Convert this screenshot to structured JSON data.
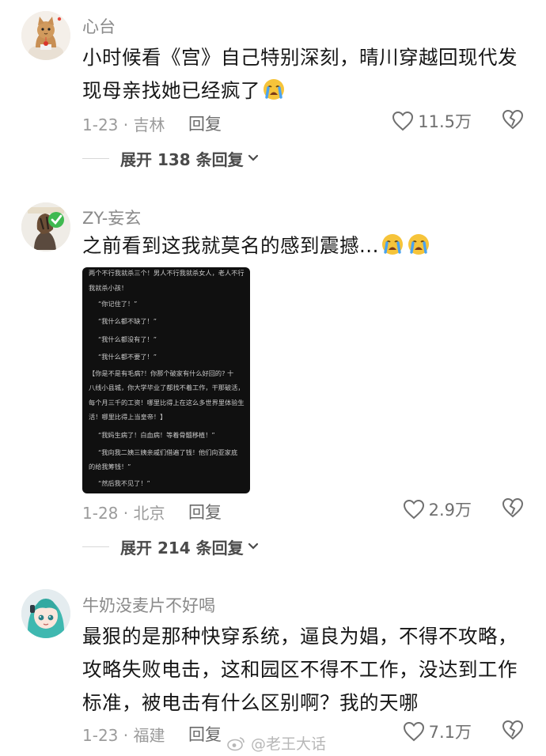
{
  "comments": [
    {
      "username": "心台",
      "content": "小时候看《宫》自己特别深刻，晴川穿越回现代发现母亲找她已经疯了",
      "date": "1-23 · 吉林",
      "reply": "回复",
      "likes": "11.5万",
      "expand": "展开 138 条回复",
      "emoji": [
        "crying-face"
      ]
    },
    {
      "username": "ZY-妄玄",
      "content": "之前看到这我就莫名的感到震撼...",
      "date": "1-28 · 北京",
      "reply": "回复",
      "likes": "2.9万",
      "expand": "展开 214 条回复",
      "emoji": [
        "crying-face",
        "crying-face"
      ],
      "attached_image": {
        "lines": [
          "两个不行我就杀三个！男人不行我就杀女人，老人不行",
          "我就杀小孩！",
          "“你记住了！”",
          "“我什么都不缺了！”",
          "“我什么都没有了！”",
          "“我什么都不要了！”",
          "【你是不是有毛病?！你那个破家有什么好回的? 十",
          "八线小县城，你大学毕业了都找不着工作，干那破活，",
          "每个月三千的工资！哪里比得上在这么多世界里体验生",
          "活！哪里比得上当皇帝！】",
          "“我妈生病了！白血病！等着骨髓移植！”",
          "“我向我二姨三姨亲戚们借遍了钱！他们向亚家底",
          "的给我筹钱！”",
          "“然后我不见了！”"
        ]
      }
    },
    {
      "username": "牛奶没麦片不好喝",
      "content_lines": [
        "最狠的是那种快穿系统，逼良为娼，不得不攻略，",
        "攻略失败电击，这和园区不得不工作，没达到工作",
        "标准，被电击有什么区别啊？我的天哪"
      ],
      "date": "1-23 · 福建",
      "reply": "回复",
      "likes": "7.1万"
    }
  ],
  "watermark": "@老王大话",
  "colors": {
    "text": "#161616",
    "meta": "#9b9b9b",
    "shot_bg": "#101010",
    "emoji_face": "#f6c43a"
  }
}
